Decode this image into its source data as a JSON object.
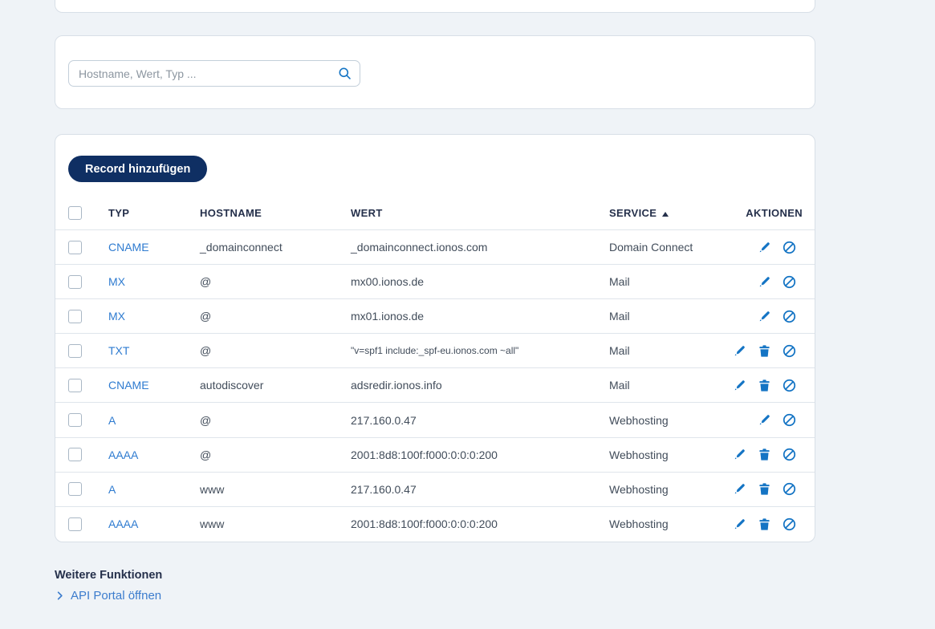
{
  "search": {
    "placeholder": "Hostname, Wert, Typ ..."
  },
  "table": {
    "add_button_label": "Record hinzufügen",
    "headers": {
      "typ": "TYP",
      "hostname": "HOSTNAME",
      "wert": "WERT",
      "service": "SERVICE",
      "aktionen": "AKTIONEN"
    },
    "sort": {
      "column": "SERVICE",
      "direction": "ascending"
    },
    "rows": [
      {
        "type": "CNAME",
        "hostname": "_domainconnect",
        "value": "_domainconnect.ionos.com",
        "service": "Domain Connect",
        "actions": [
          "edit",
          "disable"
        ]
      },
      {
        "type": "MX",
        "hostname": "@",
        "value": "mx00.ionos.de",
        "service": "Mail",
        "actions": [
          "edit",
          "disable"
        ]
      },
      {
        "type": "MX",
        "hostname": "@",
        "value": "mx01.ionos.de",
        "service": "Mail",
        "actions": [
          "edit",
          "disable"
        ]
      },
      {
        "type": "TXT",
        "hostname": "@",
        "value": "\"v=spf1 include:_spf-eu.ionos.com ~all\"",
        "service": "Mail",
        "actions": [
          "edit",
          "delete",
          "disable"
        ],
        "value_small": true
      },
      {
        "type": "CNAME",
        "hostname": "autodiscover",
        "value": "adsredir.ionos.info",
        "service": "Mail",
        "actions": [
          "edit",
          "delete",
          "disable"
        ]
      },
      {
        "type": "A",
        "hostname": "@",
        "value": "217.160.0.47",
        "service": "Webhosting",
        "actions": [
          "edit",
          "disable"
        ]
      },
      {
        "type": "AAAA",
        "hostname": "@",
        "value": "2001:8d8:100f:f000:0:0:0:200",
        "service": "Webhosting",
        "actions": [
          "edit",
          "delete",
          "disable"
        ]
      },
      {
        "type": "A",
        "hostname": "www",
        "value": "217.160.0.47",
        "service": "Webhosting",
        "actions": [
          "edit",
          "delete",
          "disable"
        ]
      },
      {
        "type": "AAAA",
        "hostname": "www",
        "value": "2001:8d8:100f:f000:0:0:0:200",
        "service": "Webhosting",
        "actions": [
          "edit",
          "delete",
          "disable"
        ]
      }
    ]
  },
  "footer": {
    "heading": "Weitere Funktionen",
    "api_link_label": "API Portal öffnen"
  },
  "colors": {
    "page_background": "#eff3f7",
    "card_background": "#ffffff",
    "accent_icon_blue": "#1474c4",
    "link_blue": "#2e7bd0",
    "button_navy": "#0f2f63",
    "header_navy": "#25304b",
    "body_text": "#414c5a"
  }
}
